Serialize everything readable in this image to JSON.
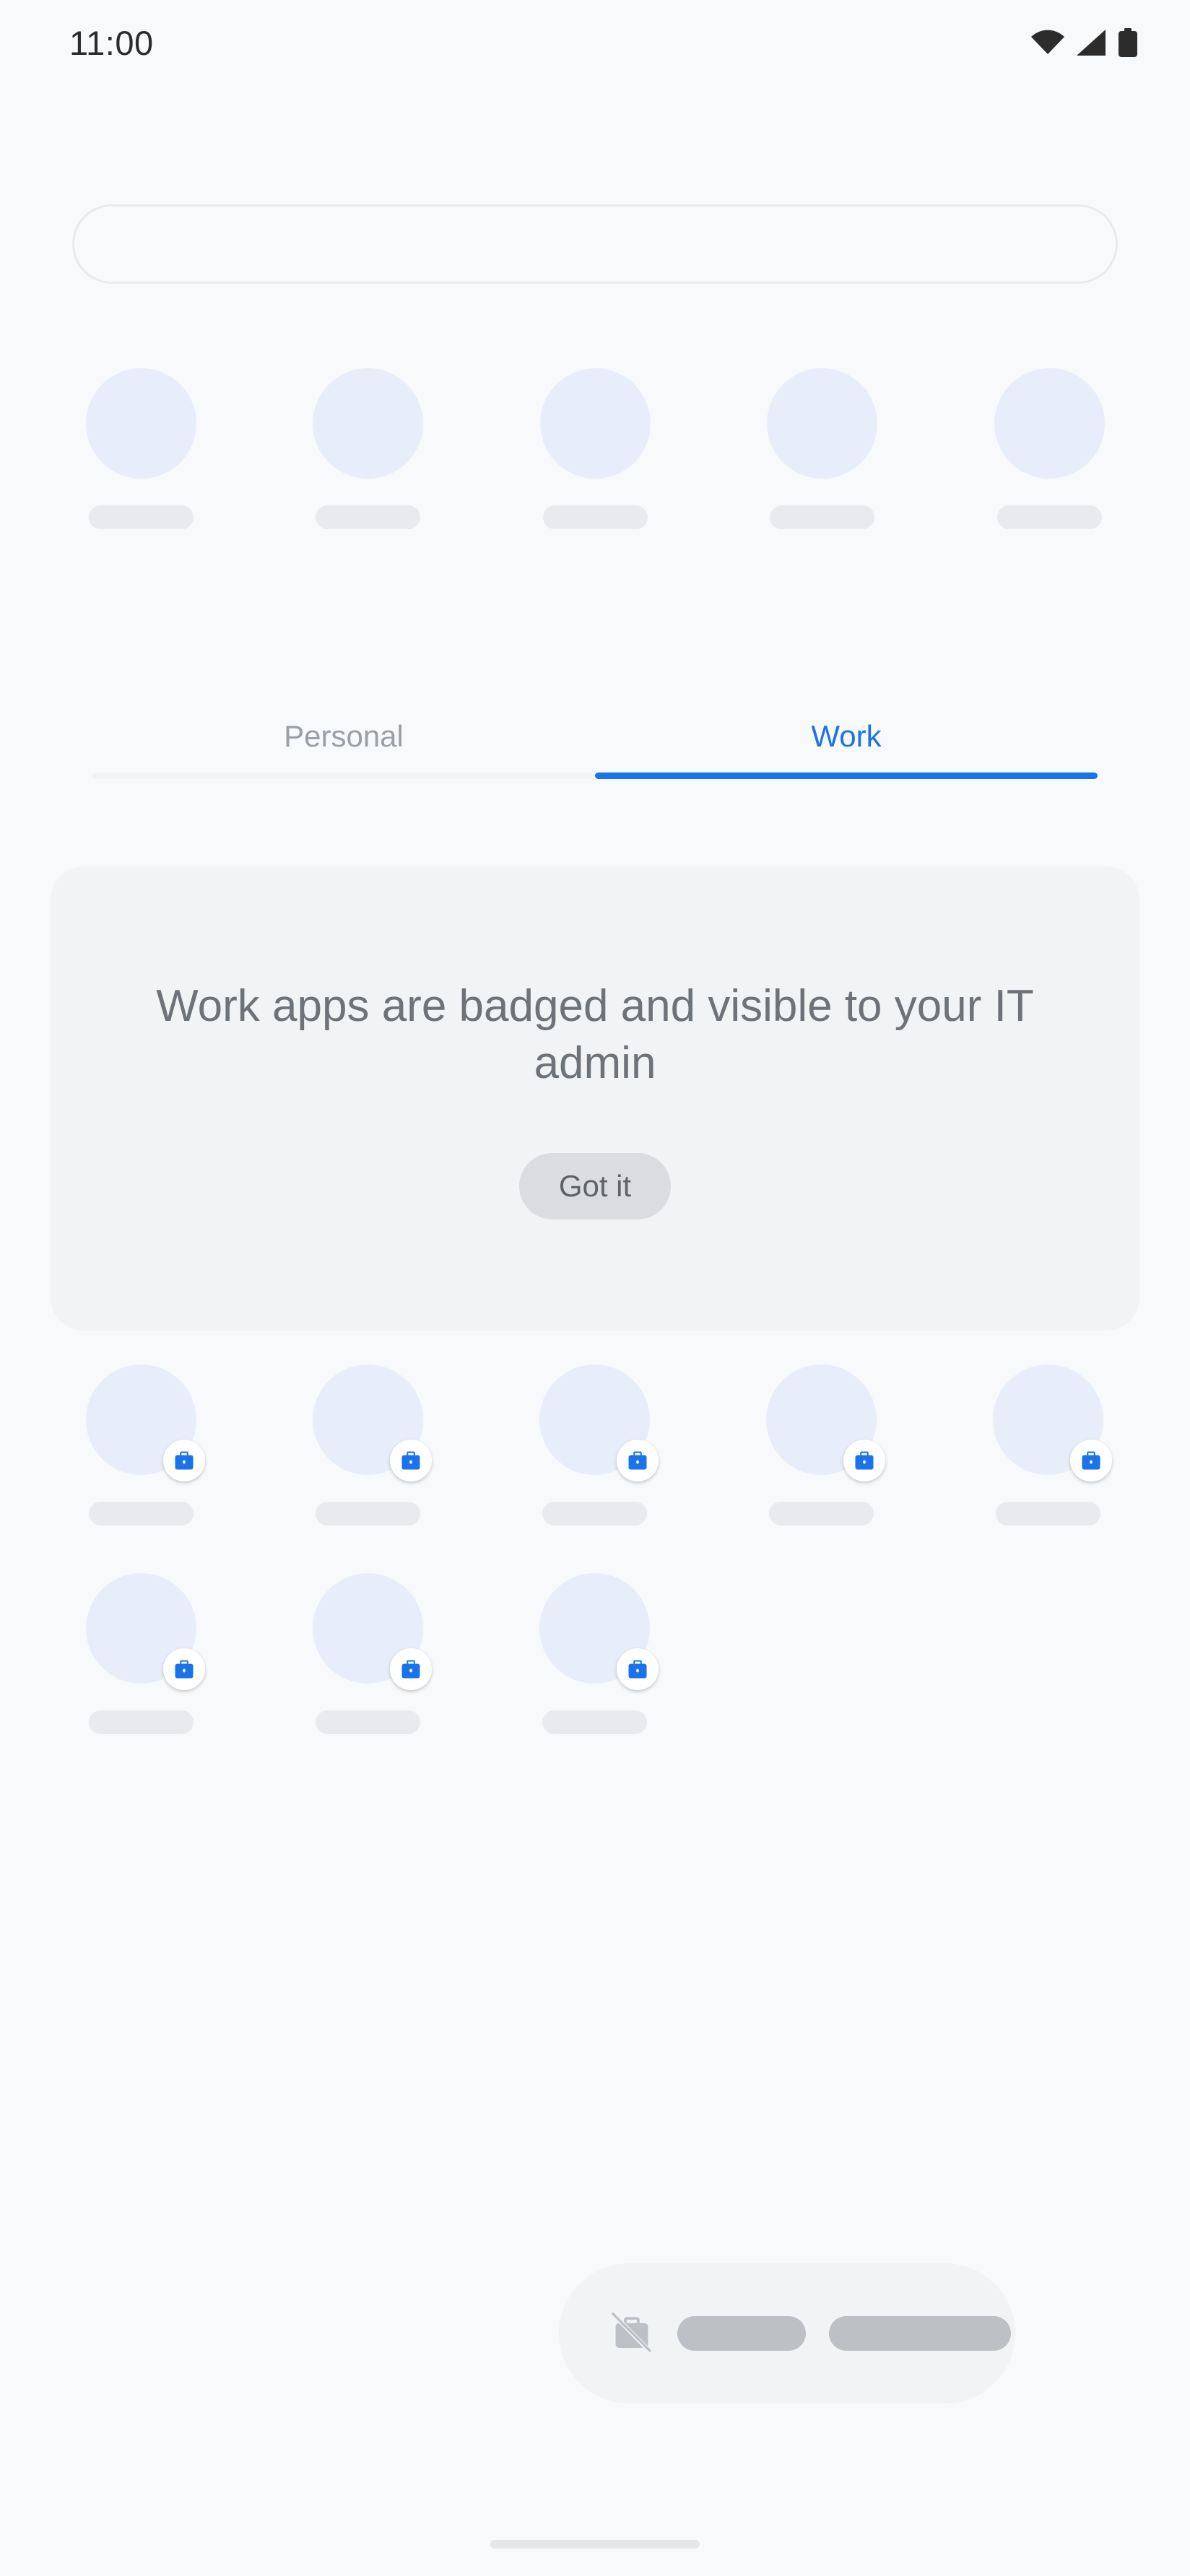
{
  "status_bar": {
    "time": "11:00",
    "icons": [
      "wifi-icon",
      "cell-signal-icon",
      "battery-icon"
    ]
  },
  "search": {
    "placeholder": "",
    "value": "",
    "icon": "search-bar"
  },
  "predictions": {
    "label": "Predicted apps row",
    "apps": [
      {
        "name": "app-placeholder-1",
        "label": ""
      },
      {
        "name": "app-placeholder-2",
        "label": ""
      },
      {
        "name": "app-placeholder-3",
        "label": ""
      },
      {
        "name": "app-placeholder-4",
        "label": ""
      },
      {
        "name": "app-placeholder-5",
        "label": ""
      }
    ]
  },
  "tabs": {
    "items": [
      {
        "label": "Personal",
        "active": false
      },
      {
        "label": "Work",
        "active": true
      }
    ],
    "active_index": 1,
    "active_color": "#1a73e8",
    "inactive_color": "#9aa0a6"
  },
  "info_card": {
    "title": "Work apps are badged and visible to your IT admin",
    "button_label": "Got it",
    "background": "#f1f3f4",
    "text_color": "#6e7379"
  },
  "work_apps": {
    "badge_icon": "work-briefcase-badge-icon",
    "badge_color": "#1a73e8",
    "rows": [
      [
        {
          "name": "work-app-1",
          "label": ""
        },
        {
          "name": "work-app-2",
          "label": ""
        },
        {
          "name": "work-app-3",
          "label": ""
        },
        {
          "name": "work-app-4",
          "label": ""
        },
        {
          "name": "work-app-5",
          "label": ""
        }
      ],
      [
        {
          "name": "work-app-6",
          "label": ""
        },
        {
          "name": "work-app-7",
          "label": ""
        },
        {
          "name": "work-app-8",
          "label": ""
        }
      ]
    ]
  },
  "bottom_bar": {
    "icon": "work-profile-off-icon",
    "pill_1": "",
    "pill_2": "",
    "background": "#f1f3f4"
  },
  "home_indicator": {
    "label": "home-gesture-bar"
  },
  "theme": {
    "page_background": "#f8f9fa",
    "icon_placeholder": "#e8edfa",
    "label_placeholder": "#e8eaed",
    "accent": "#1a73e8"
  }
}
